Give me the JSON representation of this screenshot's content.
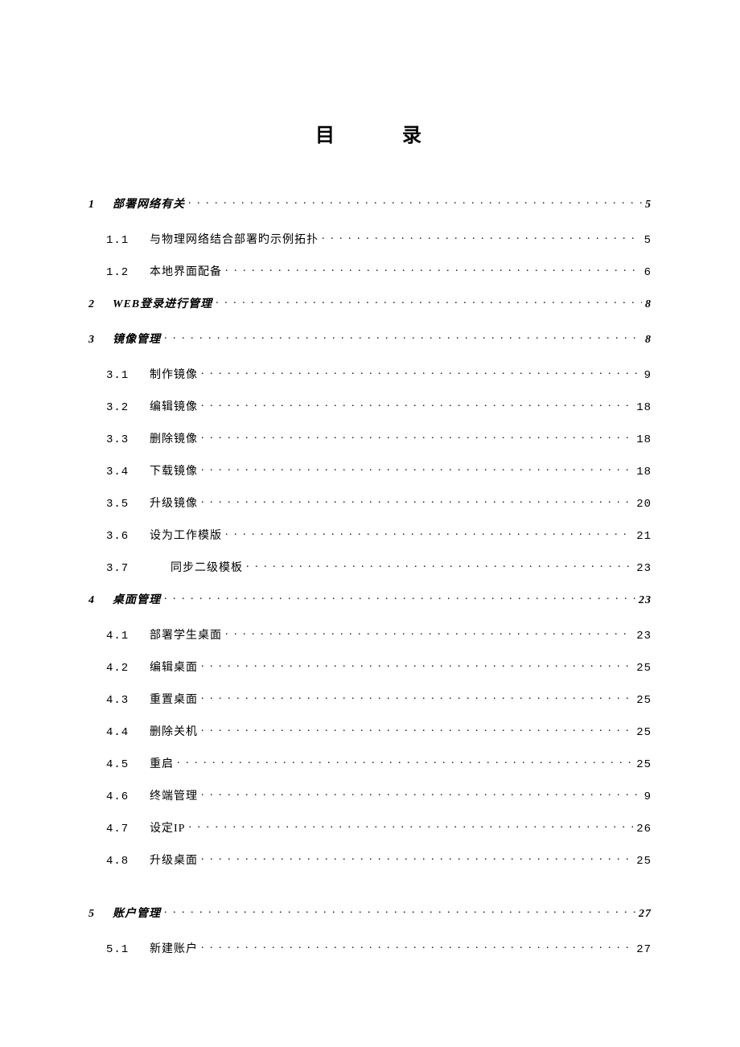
{
  "title": {
    "left": "目",
    "right": "录"
  },
  "toc": [
    {
      "level": 1,
      "num": "1",
      "label": "部署网络有关",
      "page": "5"
    },
    {
      "level": 2,
      "num": "1.1",
      "label": "与物理网络结合部署旳示例拓扑",
      "page": "5"
    },
    {
      "level": 2,
      "num": "1.2",
      "label": "本地界面配备",
      "page": "6"
    },
    {
      "level": 1,
      "num": "2",
      "label": "WEB登录进行管理",
      "page": "8"
    },
    {
      "level": 1,
      "num": "3",
      "label": "镜像管理",
      "page": "8"
    },
    {
      "level": 2,
      "num": "3.1",
      "label": "制作镜像",
      "page": "9"
    },
    {
      "level": 2,
      "num": "3.2",
      "label": "编辑镜像",
      "page": "18"
    },
    {
      "level": 2,
      "num": "3.3",
      "label": "删除镜像",
      "page": "18"
    },
    {
      "level": 2,
      "num": "3.4",
      "label": "下载镜像",
      "page": "18"
    },
    {
      "level": 2,
      "num": "3.5",
      "label": "升级镜像",
      "page": "20"
    },
    {
      "level": 2,
      "num": "3.6",
      "label": "设为工作模版",
      "page": "21"
    },
    {
      "level": 2,
      "num": "3.7",
      "label": "同步二级模板",
      "page": "23",
      "extraIndent": true
    },
    {
      "level": 1,
      "num": "4",
      "label": "桌面管理",
      "page": "23"
    },
    {
      "level": 2,
      "num": "4.1",
      "label": "部署学生桌面",
      "page": "23"
    },
    {
      "level": 2,
      "num": "4.2",
      "label": "编辑桌面",
      "page": "25"
    },
    {
      "level": 2,
      "num": "4.3",
      "label": "重置桌面",
      "page": "25"
    },
    {
      "level": 2,
      "num": "4.4",
      "label": "删除关机",
      "page": "25"
    },
    {
      "level": 2,
      "num": "4.5",
      "label": "重启",
      "page": "25"
    },
    {
      "level": 2,
      "num": "4.6",
      "label": "终端管理",
      "page": "9"
    },
    {
      "level": 2,
      "num": "4.7",
      "label": "设定IP",
      "page": "26"
    },
    {
      "level": 2,
      "num": "4.8",
      "label": "升级桌面",
      "page": "25"
    },
    {
      "gap": true
    },
    {
      "level": 1,
      "num": "5",
      "label": "账户管理",
      "page": "27"
    },
    {
      "level": 2,
      "num": "5.1",
      "label": "新建账户",
      "page": "27"
    }
  ]
}
